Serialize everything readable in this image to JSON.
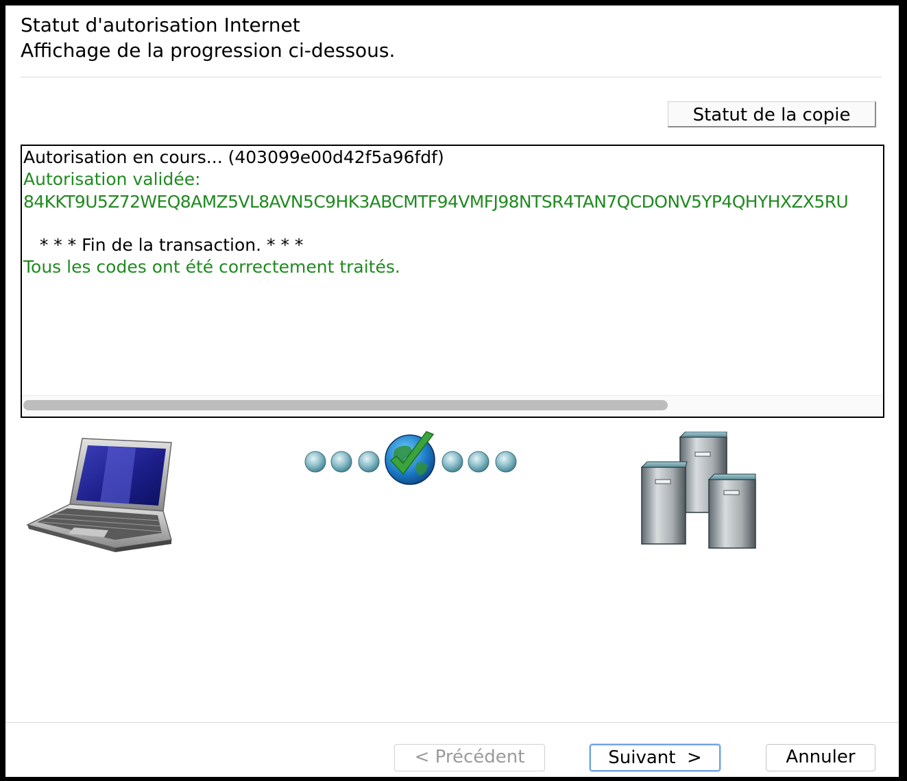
{
  "header": {
    "title": "Statut d'autorisation Internet",
    "subtitle": "Affichage de la progression ci-dessous."
  },
  "copy_status_button": "Statut de la copie",
  "log": {
    "line1": "Autorisation en cours... (403099e00d42f5a96fdf)",
    "line2": "Autorisation validée:",
    "line3": "84KKT9U5Z72WEQ8AMZ5VL8AVN5C9HK3ABCMTF94VMFJ98NTSR4TAN7QCDONV5YP4QHYHXZX5RU",
    "line4": "   * * * Fin de la transaction. * * *",
    "line5": "Tous les codes ont été correctement traités."
  },
  "icons": {
    "client": "laptop-icon",
    "progress": "globe-checkmark-icon",
    "server": "servers-icon"
  },
  "colors": {
    "success_text": "#1f8a1f",
    "focus_ring": "#6fa2e0"
  },
  "footer": {
    "prev_label": "< Précédent",
    "next_label": "Suivant  >",
    "cancel_label": "Annuler"
  }
}
